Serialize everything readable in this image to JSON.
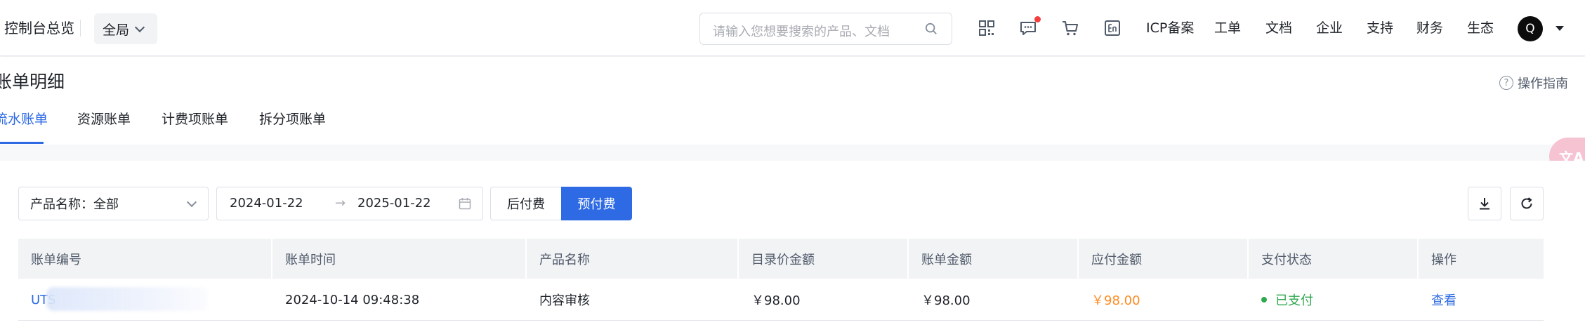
{
  "topnav": {
    "overview": "控制台总览",
    "scope": "全局",
    "search_placeholder": "请输入您想要搜索的产品、文档",
    "links": [
      "ICP备案",
      "工单",
      "文档",
      "企业",
      "支持",
      "财务",
      "生态"
    ],
    "avatar": "Q",
    "icons": [
      "qrcode-icon",
      "message-icon",
      "cart-icon",
      "language-en-icon"
    ]
  },
  "header": {
    "title": "账单明细",
    "guide": "操作指南",
    "tabs": [
      "流水账单",
      "资源账单",
      "计费项账单",
      "拆分项账单"
    ]
  },
  "filters": {
    "product_select": "产品名称：全部",
    "date_start": "2024-01-22",
    "date_arrow": "→",
    "date_end": "2025-01-22",
    "pay_post": "后付费",
    "pay_pre": "预付费"
  },
  "table": {
    "columns": [
      "账单编号",
      "账单时间",
      "产品名称",
      "目录价金额",
      "账单金额",
      "应付金额",
      "支付状态",
      "操作"
    ],
    "rows": [
      {
        "id": "UTS",
        "time": "2024-10-14 09:48:38",
        "product": "内容审核",
        "list_price": "￥98.00",
        "bill_amount": "￥98.00",
        "payable": "￥98.00",
        "status": "已支付",
        "action": "查看"
      }
    ]
  },
  "colors": {
    "primary": "#2d6ae3",
    "payable": "#ff8a1f",
    "paid": "#2fa84f",
    "badge": "#f53f3f"
  }
}
